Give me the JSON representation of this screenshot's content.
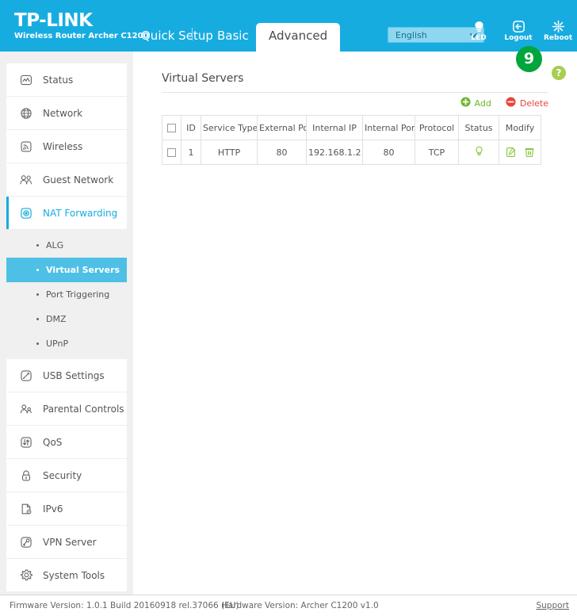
{
  "header": {
    "brand_logo": "TP-LINK",
    "brand_sub": "Wireless Router Archer C1200",
    "tabs": [
      {
        "label": "Quick Setup",
        "active": false
      },
      {
        "label": "Basic",
        "active": false
      },
      {
        "label": "Advanced",
        "active": true
      }
    ],
    "language": {
      "value": "English",
      "icon": "chevron-down-icon"
    },
    "icons": [
      {
        "name": "led-icon",
        "label": "LED"
      },
      {
        "name": "logout-icon",
        "label": "Logout"
      },
      {
        "name": "reboot-icon",
        "label": "Reboot"
      }
    ],
    "colors": {
      "bar": "#17ace0",
      "tab_active_bg": "#ffffff"
    }
  },
  "annotation": {
    "badge_number": "9",
    "badge_color": "#00a63c",
    "help_label": "?",
    "help_color": "#a7ce4f"
  },
  "sidebar": {
    "items": [
      {
        "label": "Status",
        "icon": "status-monitor-icon",
        "active": false
      },
      {
        "label": "Network",
        "icon": "globe-icon",
        "active": false
      },
      {
        "label": "Wireless",
        "icon": "wireless-signal-icon",
        "active": false
      },
      {
        "label": "Guest Network",
        "icon": "guest-users-icon",
        "active": false
      },
      {
        "label": "NAT Forwarding",
        "icon": "nat-forwarding-icon",
        "active": true
      },
      {
        "label": "USB Settings",
        "icon": "usb-icon",
        "active": false
      },
      {
        "label": "Parental Controls",
        "icon": "parental-controls-icon",
        "active": false
      },
      {
        "label": "QoS",
        "icon": "qos-arrows-icon",
        "active": false
      },
      {
        "label": "Security",
        "icon": "lock-icon",
        "active": false
      },
      {
        "label": "IPv6",
        "icon": "ipv6-document-icon",
        "active": false
      },
      {
        "label": "VPN Server",
        "icon": "vpn-key-icon",
        "active": false
      },
      {
        "label": "System Tools",
        "icon": "gear-icon",
        "active": false
      }
    ],
    "submenu": {
      "parent": "NAT Forwarding",
      "items": [
        {
          "label": "ALG",
          "active": false
        },
        {
          "label": "Virtual Servers",
          "active": true
        },
        {
          "label": "Port Triggering",
          "active": false
        },
        {
          "label": "DMZ",
          "active": false
        },
        {
          "label": "UPnP",
          "active": false
        }
      ],
      "active_color": "#4ec0e5"
    }
  },
  "main": {
    "page_title": "Virtual Servers",
    "actions": {
      "add_label": "Add",
      "add_icon": "plus-circle-icon",
      "add_color": "#6cb52d",
      "delete_label": "Delete",
      "delete_icon": "minus-circle-icon",
      "delete_color": "#e8453c"
    },
    "table": {
      "columns": [
        "",
        "ID",
        "Service Type",
        "External Port",
        "Internal IP",
        "Internal Port",
        "Protocol",
        "Status",
        "Modify"
      ],
      "rows": [
        {
          "selected": false,
          "id": "1",
          "service_type": "HTTP",
          "external_port": "80",
          "internal_ip": "192.168.1.2",
          "internal_port": "80",
          "protocol": "TCP",
          "status_icon": "bulb-icon",
          "modify_icons": [
            "edit-icon",
            "delete-trash-icon"
          ]
        }
      ]
    }
  },
  "footer": {
    "firmware": "Firmware Version: 1.0.1 Build 20160918 rel.37066 (EU)",
    "hardware": "Hardware Version: Archer C1200 v1.0",
    "support": "Support"
  }
}
